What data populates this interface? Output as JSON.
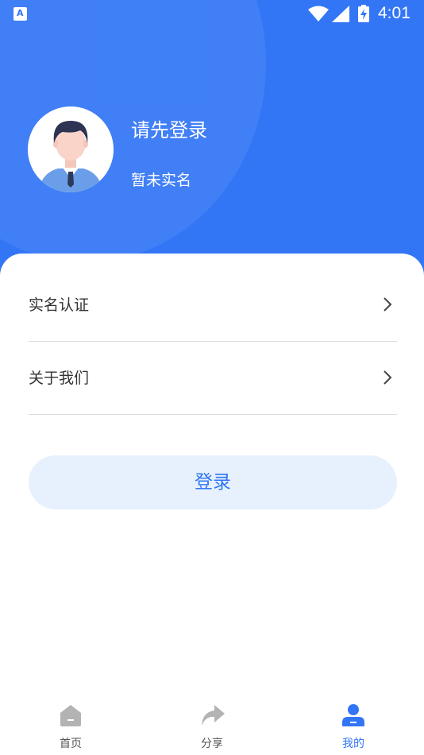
{
  "status_bar": {
    "app_icon_letter": "A",
    "time": "4:01"
  },
  "profile": {
    "login_prompt": "请先登录",
    "realname_status": "暂未实名",
    "avatar_icon": "user-avatar-illustration"
  },
  "menu": {
    "items": [
      {
        "label": "实名认证",
        "icon": "chevron-right-icon"
      },
      {
        "label": "关于我们",
        "icon": "chevron-right-icon"
      }
    ]
  },
  "login_button_label": "登录",
  "tabbar": {
    "tabs": [
      {
        "label": "首页",
        "icon": "home-icon",
        "active": false
      },
      {
        "label": "分享",
        "icon": "share-icon",
        "active": false
      },
      {
        "label": "我的",
        "icon": "user-icon",
        "active": true
      }
    ]
  },
  "colors": {
    "primary": "#3276f6",
    "button_bg": "#e7f1fd",
    "inactive_icon": "#b3b3b3"
  }
}
